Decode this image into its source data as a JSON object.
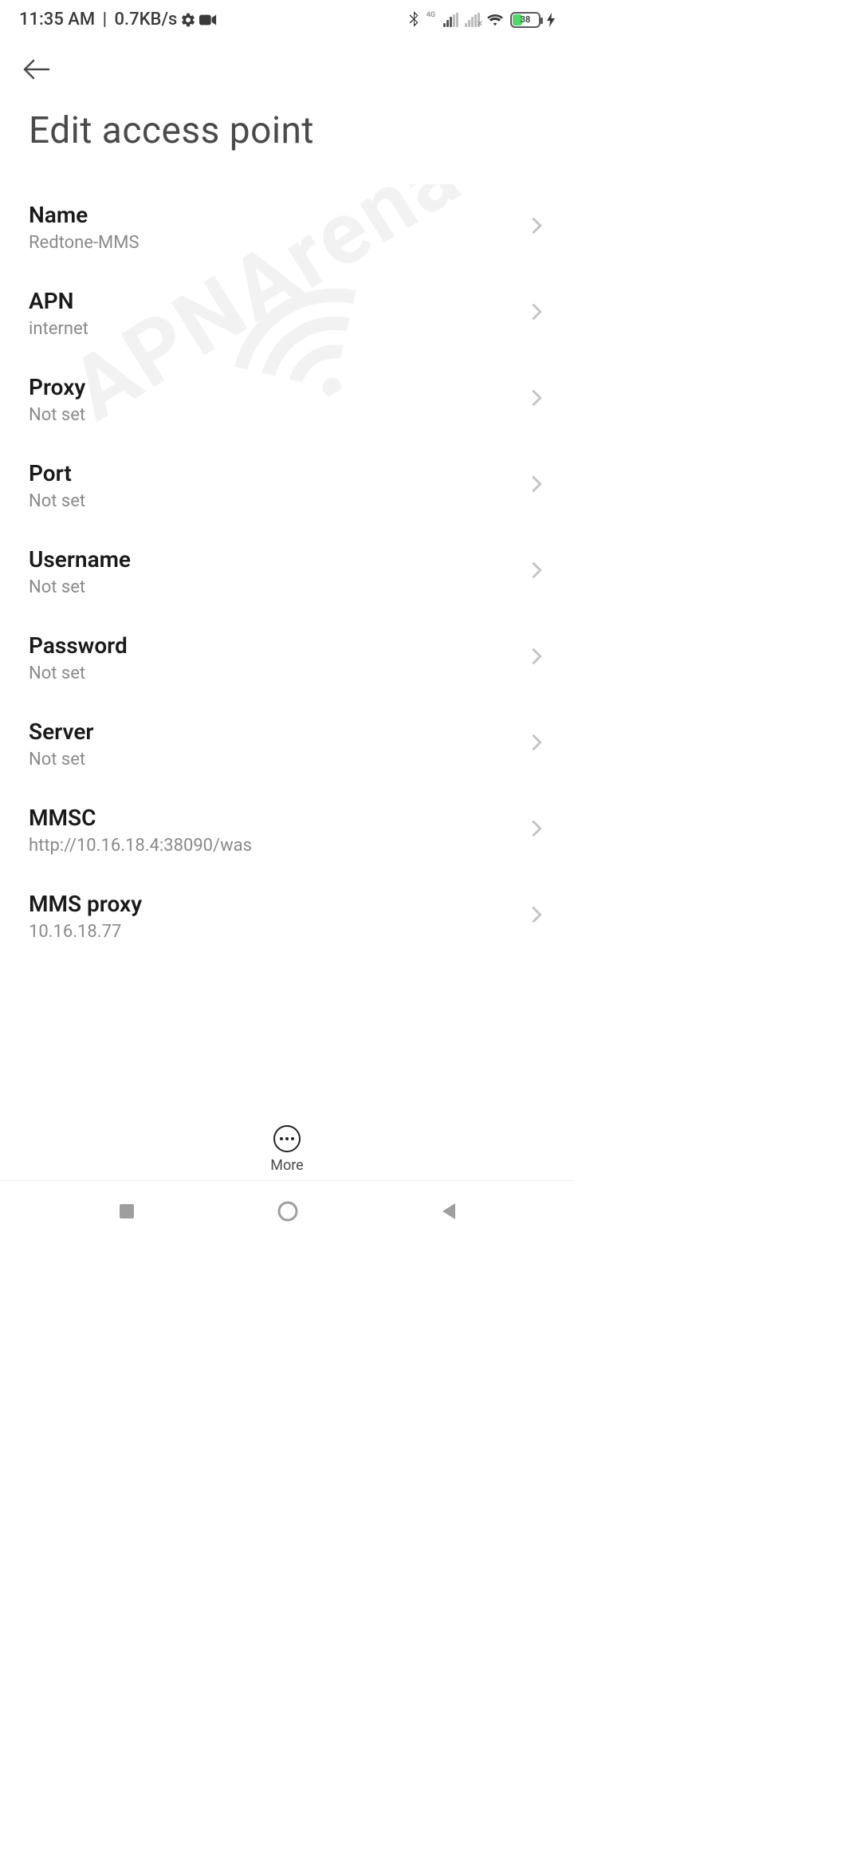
{
  "status": {
    "time": "11:35 AM",
    "net_speed": "0.7KB/s",
    "signal_badge": "4G",
    "battery_pct": "38"
  },
  "page": {
    "title": "Edit access point"
  },
  "settings": [
    {
      "label": "Name",
      "value": "Redtone-MMS"
    },
    {
      "label": "APN",
      "value": "internet"
    },
    {
      "label": "Proxy",
      "value": "Not set"
    },
    {
      "label": "Port",
      "value": "Not set"
    },
    {
      "label": "Username",
      "value": "Not set"
    },
    {
      "label": "Password",
      "value": "Not set"
    },
    {
      "label": "Server",
      "value": "Not set"
    },
    {
      "label": "MMSC",
      "value": "http://10.16.18.4:38090/was"
    },
    {
      "label": "MMS proxy",
      "value": "10.16.18.77"
    }
  ],
  "more_label": "More",
  "watermark": "APNArena"
}
